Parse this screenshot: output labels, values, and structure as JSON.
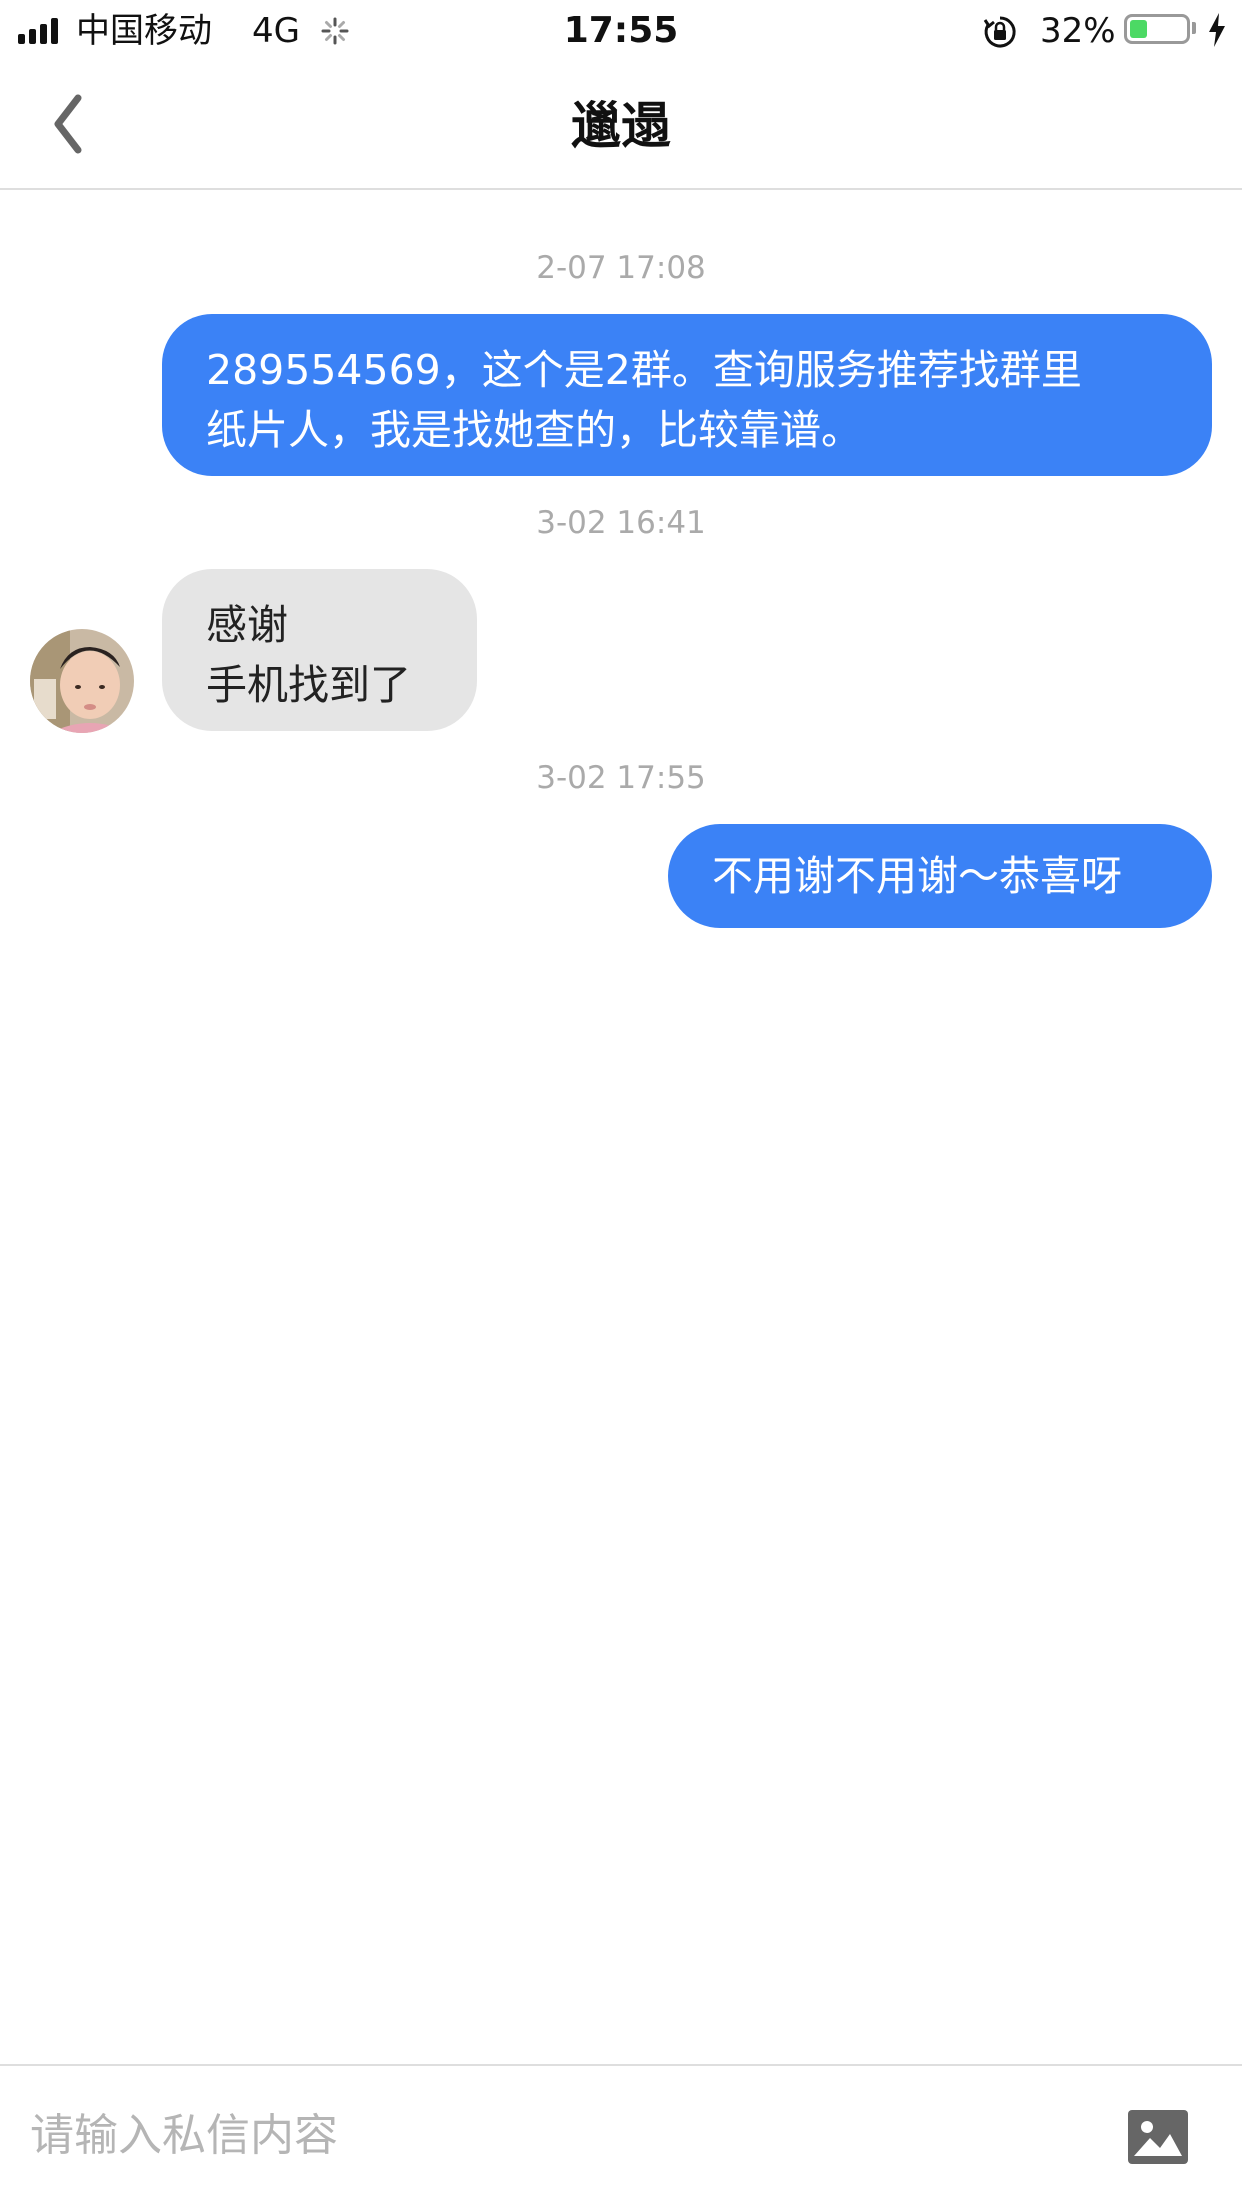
{
  "status_bar": {
    "carrier": "中国移动",
    "network": "4G",
    "time": "17:55",
    "battery_percent_label": "32%",
    "battery_level": 0.32,
    "battery_color": "#4cd964"
  },
  "nav": {
    "title": "邋遢",
    "back_icon": "chevron-left-icon"
  },
  "messages": [
    {
      "timestamp": "2-07 17:08",
      "direction": "outgoing",
      "text": "289554569，这个是2群。查询服务推荐找群里\n纸片人，我是找她查的，比较靠谱。"
    },
    {
      "timestamp": "3-02 16:41",
      "direction": "incoming",
      "text": "感谢\n手机找到了"
    },
    {
      "timestamp": "3-02 17:55",
      "direction": "outgoing",
      "text": "不用谢不用谢～恭喜呀"
    }
  ],
  "input": {
    "placeholder": "请输入私信内容",
    "value": "",
    "image_icon": "image-icon"
  },
  "colors": {
    "outgoing_bubble": "#3b82f6",
    "incoming_bubble": "#e5e5e5",
    "timestamp_text": "#aaaaaa",
    "placeholder_text": "#b5b5b5"
  }
}
